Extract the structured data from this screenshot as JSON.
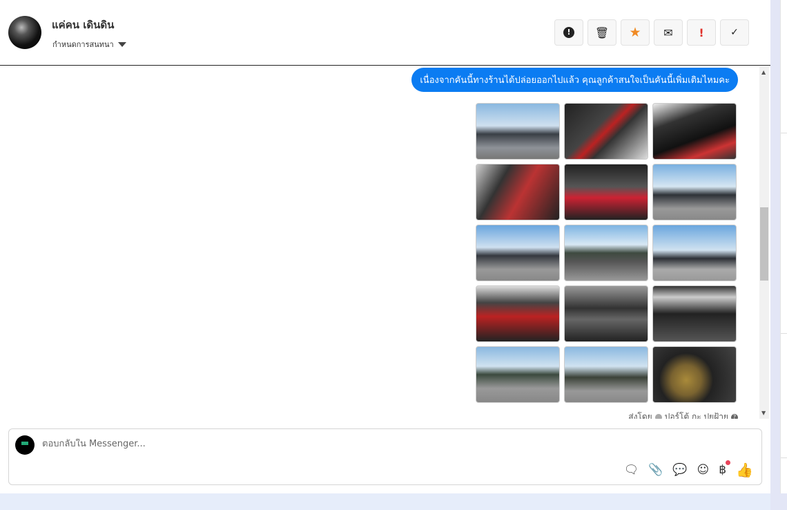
{
  "header": {
    "name": "แค่คน เดินดิน",
    "assign_label": "กำหนดการสนทนา"
  },
  "actions": [
    {
      "name": "spam-button",
      "icon": "!",
      "color": "#222"
    },
    {
      "name": "delete-button",
      "icon": "🗑",
      "color": "#333"
    },
    {
      "name": "star-button",
      "icon": "★",
      "color": "#f08a24"
    },
    {
      "name": "unread-button",
      "icon": "✉",
      "color": "#222"
    },
    {
      "name": "important-button",
      "icon": "!",
      "color": "#e0302a"
    },
    {
      "name": "done-button",
      "icon": "✓",
      "color": "#333"
    }
  ],
  "chat": {
    "message": "เนื่องจากคันนี้ทางร้านได้ปล่อยออกไปแล้ว คุณลูกค้าสนใจเป็นคันนี้เพิ่มเติมไหมคะ",
    "sent_by_label": "ส่งโดย",
    "sender": "ปอร์โต้ กะ ปยฝ้าย",
    "photo_count": 15
  },
  "composer": {
    "placeholder": "ตอบกลับใน Messenger..."
  },
  "colors": {
    "accent": "#0b7cf2",
    "star": "#f08a24",
    "alert": "#e0302a"
  }
}
